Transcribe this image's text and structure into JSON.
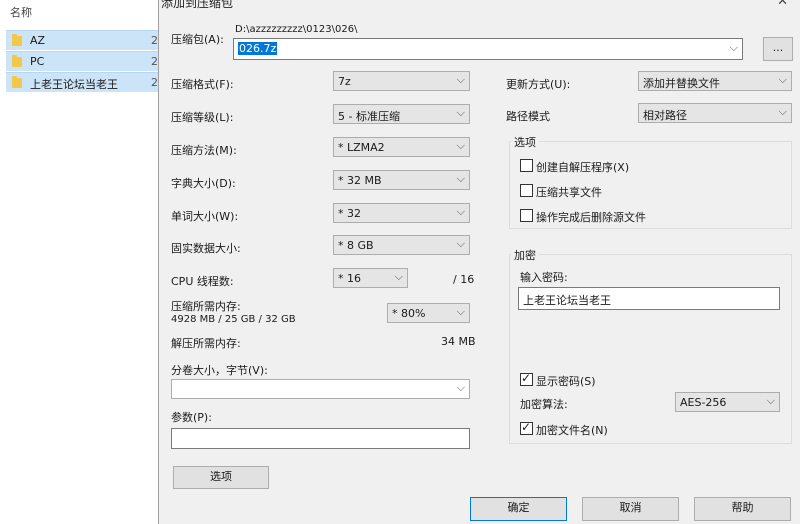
{
  "explorer": {
    "header_label": "名称",
    "sort_indicator": "^",
    "rows": [
      {
        "label": "AZ",
        "trail": "2"
      },
      {
        "label": "PC",
        "trail": "2"
      },
      {
        "label": "上老王论坛当老王",
        "trail": "2"
      }
    ]
  },
  "dialog": {
    "title": "添加到压缩包",
    "close": "✕",
    "archive": {
      "label": "压缩包(A):",
      "path": "D:\\azzzzzzzzz\\0123\\026\\",
      "filename": "026.7z",
      "browse": "..."
    },
    "left": {
      "format": {
        "label": "压缩格式(F):",
        "value": "7z"
      },
      "level": {
        "label": "压缩等级(L):",
        "value": "5 - 标准压缩"
      },
      "method": {
        "label": "压缩方法(M):",
        "value": "* LZMA2"
      },
      "dict": {
        "label": "字典大小(D):",
        "value": "* 32 MB"
      },
      "word": {
        "label": "单词大小(W):",
        "value": "* 32"
      },
      "solid": {
        "label": "固实数据大小:",
        "value": "* 8 GB"
      },
      "cpu": {
        "label": "CPU 线程数:",
        "value": "* 16",
        "max": "/ 16"
      },
      "mem_comp": {
        "label": "压缩所需内存:",
        "detail": "4928 MB / 25 GB / 32 GB",
        "value": "* 80%"
      },
      "mem_decomp": {
        "label": "解压所需内存:",
        "value": "34 MB"
      },
      "split": {
        "label": "分卷大小，字节(V):",
        "value": ""
      },
      "params": {
        "label": "参数(P):",
        "value": ""
      },
      "options_button": "选项"
    },
    "right": {
      "update": {
        "label": "更新方式(U):",
        "value": "添加并替换文件"
      },
      "path_mode": {
        "label": "路径模式",
        "value": "相对路径"
      },
      "options_group": {
        "title": "选项",
        "sfx": "创建自解压程序(X)",
        "shared": "压缩共享文件",
        "delete": "操作完成后删除源文件"
      },
      "encryption": {
        "title": "加密",
        "password_label": "输入密码:",
        "password_value": "上老王论坛当老王",
        "show_password": "显示密码(S)",
        "method_label": "加密算法:",
        "method_value": "AES-256",
        "encrypt_names": "加密文件名(N)"
      }
    },
    "buttons": {
      "ok": "确定",
      "cancel": "取消",
      "help": "帮助"
    },
    "icons": {
      "dropdown": "chevron-down-icon",
      "checked": "check-icon",
      "folder": "folder-icon",
      "close": "close-icon"
    }
  }
}
